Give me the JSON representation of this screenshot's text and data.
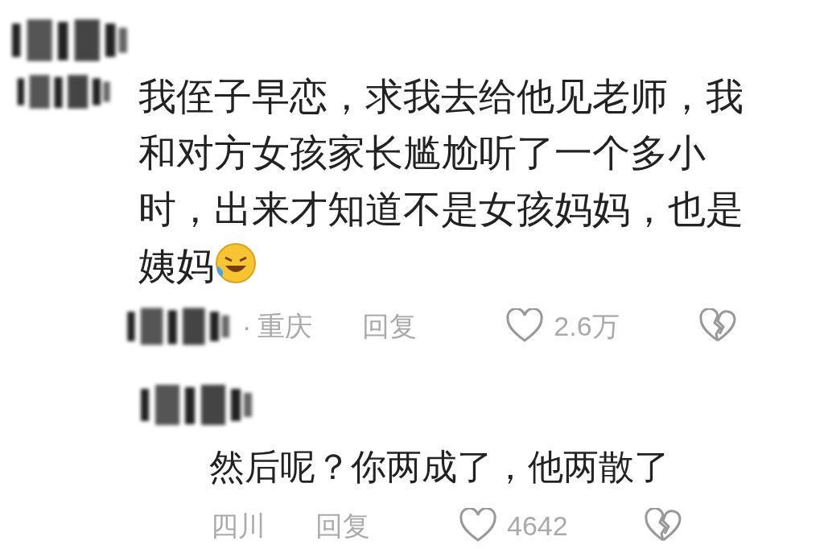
{
  "comments": [
    {
      "text": "我侄子早恋，求我去给他见老师，我和对方女孩家长尴尬听了一个多小时，出来才知道不是女孩妈妈，也是姨妈",
      "has_emoji": true,
      "separator": "·",
      "location": "重庆",
      "reply": "回复",
      "likes": "2.6万"
    },
    {
      "text": "然后呢？你两成了，他两散了",
      "has_emoji": false,
      "location": "四川",
      "reply": "回复",
      "likes": "4642"
    }
  ]
}
